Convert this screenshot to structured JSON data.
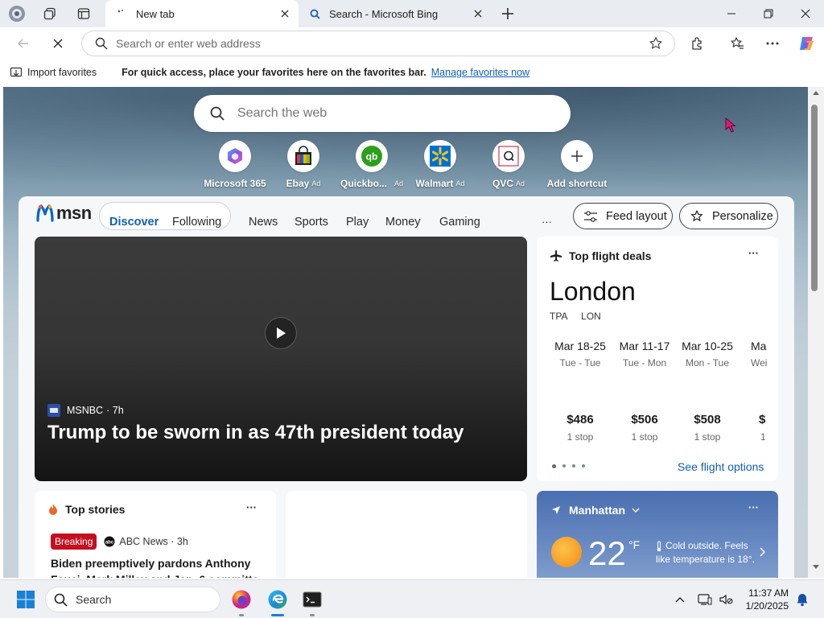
{
  "tabs": [
    {
      "title": "New tab",
      "active": true
    },
    {
      "title": "Search - Microsoft Bing",
      "active": false
    }
  ],
  "address": {
    "placeholder": "Search or enter web address"
  },
  "favorites_bar": {
    "import_label": "Import favorites",
    "message": "For quick access, place your favorites here on the favorites bar.",
    "manage_link": "Manage favorites now"
  },
  "search": {
    "placeholder": "Search the web"
  },
  "shortcuts": [
    {
      "label": "Microsoft 365",
      "ad": ""
    },
    {
      "label": "Ebay",
      "ad": "Ad"
    },
    {
      "label": "Quickbo...",
      "ad": "Ad"
    },
    {
      "label": "Walmart",
      "ad": "Ad"
    },
    {
      "label": "QVC",
      "ad": "Ad"
    },
    {
      "label": "Add shortcut",
      "ad": ""
    }
  ],
  "msn": {
    "logo": "msn",
    "tabs": [
      "Discover",
      "Following"
    ],
    "nav": [
      "News",
      "Sports",
      "Play",
      "Money",
      "Gaming"
    ],
    "more": "···",
    "feed_layout": "Feed layout",
    "personalize": "Personalize"
  },
  "hero": {
    "source": "MSNBC",
    "age": "· 7h",
    "headline": "Trump to be sworn in as 47th president today"
  },
  "flight": {
    "title": "Top flight deals",
    "city": "London",
    "from": "TPA",
    "to": "LON",
    "dates": [
      {
        "range": "Mar 18-25",
        "days": "Tue - Tue",
        "price": "$486",
        "stops": "1 stop"
      },
      {
        "range": "Mar 11-17",
        "days": "Tue - Mon",
        "price": "$506",
        "stops": "1 stop"
      },
      {
        "range": "Mar 10-25",
        "days": "Mon - Tue",
        "price": "$508",
        "stops": "1 stop"
      },
      {
        "range": "Ma",
        "days": "Wei",
        "price": "$",
        "stops": "1"
      }
    ],
    "link": "See flight options"
  },
  "stories": {
    "title": "Top stories",
    "badge": "Breaking",
    "source": "ABC News · 3h",
    "headline_line1": "Biden preemptively pardons Anthony",
    "headline_line2": "Fauci, Mark Milley and Jan. 6 committe"
  },
  "weather": {
    "location": "Manhattan",
    "temp": "22",
    "unit": "°F",
    "note_line1": "Cold outside. Feels",
    "note_line2": "like temperature is 18°."
  },
  "taskbar": {
    "search_label": "Search",
    "time": "11:37 AM",
    "date": "1/20/2025"
  },
  "colors": {
    "accent": "#0067b8",
    "link": "#0f5fb5",
    "breaking": "#c50f1f"
  }
}
